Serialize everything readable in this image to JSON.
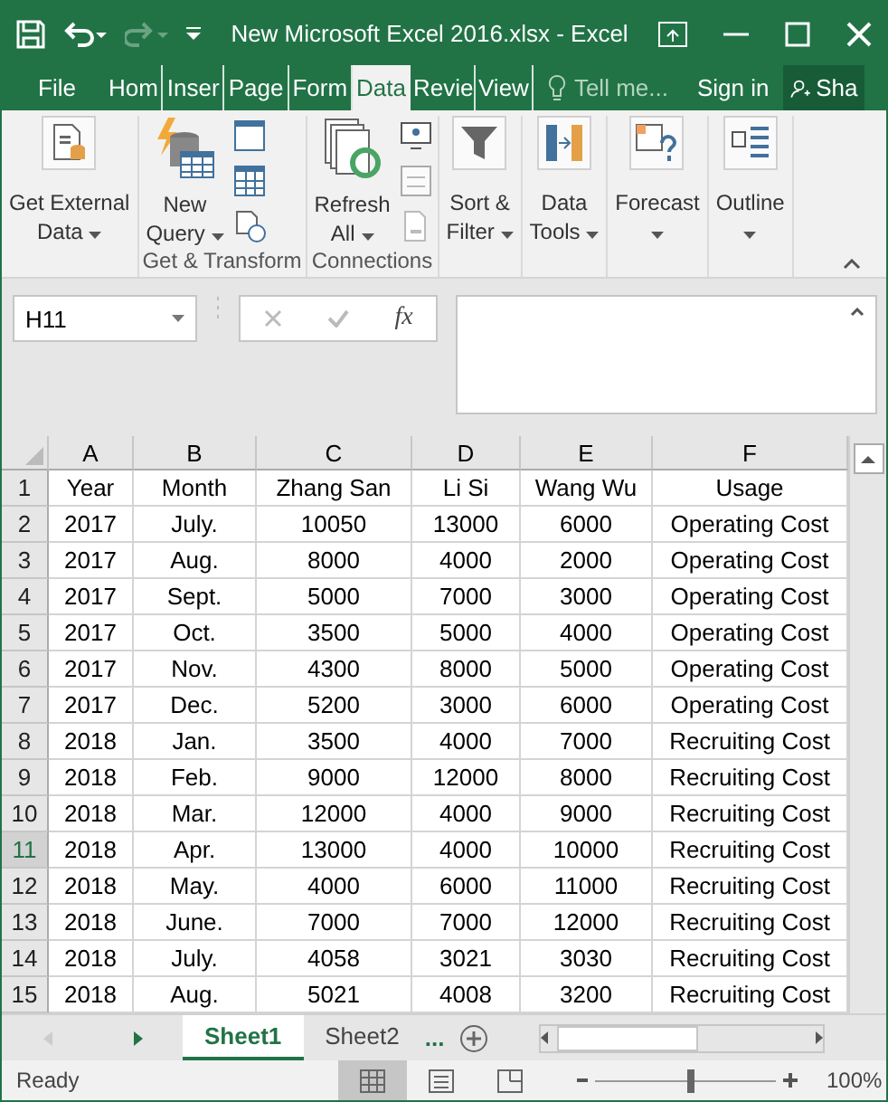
{
  "window": {
    "title": "New Microsoft Excel 2016.xlsx - Excel"
  },
  "ribbon_tabs": [
    {
      "label": "File",
      "selected": false
    },
    {
      "label": "Hom",
      "selected": false
    },
    {
      "label": "Inser",
      "selected": false
    },
    {
      "label": "Page",
      "selected": false
    },
    {
      "label": "Form",
      "selected": false
    },
    {
      "label": "Data",
      "selected": true
    },
    {
      "label": "Revie",
      "selected": false
    },
    {
      "label": "View",
      "selected": false
    }
  ],
  "tell_me": {
    "placeholder": "Tell me..."
  },
  "sign_in": "Sign in",
  "share": "Sha",
  "ribbon_groups": [
    {
      "items": [
        {
          "kind": "large",
          "lines": [
            "Get External",
            "Data"
          ]
        }
      ]
    },
    {
      "label": "Get & Transform",
      "items": [
        {
          "kind": "large",
          "lines": [
            "New",
            "Query"
          ]
        },
        {
          "kind": "smallstack"
        }
      ]
    },
    {
      "label": "Connections",
      "items": [
        {
          "kind": "large",
          "lines": [
            "Refresh",
            "All"
          ]
        },
        {
          "kind": "smallstack"
        }
      ]
    },
    {
      "items": [
        {
          "kind": "large",
          "lines": [
            "Sort &",
            "Filter"
          ]
        }
      ]
    },
    {
      "items": [
        {
          "kind": "large",
          "lines": [
            "Data",
            "Tools"
          ]
        }
      ]
    },
    {
      "items": [
        {
          "kind": "large",
          "lines": [
            "Forecast"
          ]
        }
      ]
    },
    {
      "items": [
        {
          "kind": "large",
          "lines": [
            "Outline"
          ]
        }
      ]
    }
  ],
  "name_box": "H11",
  "formula_fx": "fx",
  "sheet": {
    "columns": [
      "A",
      "B",
      "C",
      "D",
      "E",
      "F"
    ],
    "rows": [
      {
        "n": "1",
        "selected": false,
        "cells": [
          "Year",
          "Month",
          "Zhang San",
          "Li Si",
          "Wang Wu",
          "Usage"
        ]
      },
      {
        "n": "2",
        "selected": false,
        "cells": [
          "2017",
          "July.",
          "10050",
          "13000",
          "6000",
          "Operating Cost"
        ]
      },
      {
        "n": "3",
        "selected": false,
        "cells": [
          "2017",
          "Aug.",
          "8000",
          "4000",
          "2000",
          "Operating Cost"
        ]
      },
      {
        "n": "4",
        "selected": false,
        "cells": [
          "2017",
          "Sept.",
          "5000",
          "7000",
          "3000",
          "Operating Cost"
        ]
      },
      {
        "n": "5",
        "selected": false,
        "cells": [
          "2017",
          "Oct.",
          "3500",
          "5000",
          "4000",
          "Operating Cost"
        ]
      },
      {
        "n": "6",
        "selected": false,
        "cells": [
          "2017",
          "Nov.",
          "4300",
          "8000",
          "5000",
          "Operating Cost"
        ]
      },
      {
        "n": "7",
        "selected": false,
        "cells": [
          "2017",
          "Dec.",
          "5200",
          "3000",
          "6000",
          "Operating Cost"
        ]
      },
      {
        "n": "8",
        "selected": false,
        "cells": [
          "2018",
          "Jan.",
          "3500",
          "4000",
          "7000",
          "Recruiting Cost"
        ]
      },
      {
        "n": "9",
        "selected": false,
        "cells": [
          "2018",
          "Feb.",
          "9000",
          "12000",
          "8000",
          "Recruiting Cost"
        ]
      },
      {
        "n": "10",
        "selected": false,
        "cells": [
          "2018",
          "Mar.",
          "12000",
          "4000",
          "9000",
          "Recruiting Cost"
        ]
      },
      {
        "n": "11",
        "selected": true,
        "cells": [
          "2018",
          "Apr.",
          "13000",
          "4000",
          "10000",
          "Recruiting Cost"
        ]
      },
      {
        "n": "12",
        "selected": false,
        "cells": [
          "2018",
          "May.",
          "4000",
          "6000",
          "11000",
          "Recruiting Cost"
        ]
      },
      {
        "n": "13",
        "selected": false,
        "cells": [
          "2018",
          "June.",
          "7000",
          "7000",
          "12000",
          "Recruiting Cost"
        ]
      },
      {
        "n": "14",
        "selected": false,
        "cells": [
          "2018",
          "July.",
          "4058",
          "3021",
          "3030",
          "Recruiting Cost"
        ]
      },
      {
        "n": "15",
        "selected": false,
        "cells": [
          "2018",
          "Aug.",
          "5021",
          "4008",
          "3200",
          "Recruiting Cost"
        ]
      }
    ]
  },
  "sheet_tabs": [
    {
      "label": "Sheet1",
      "selected": true
    },
    {
      "label": "Sheet2",
      "selected": false
    }
  ],
  "more_sheets": "...",
  "status": "Ready",
  "views": [
    {
      "kind": "normal",
      "selected": true
    },
    {
      "kind": "page-layout",
      "selected": false
    },
    {
      "kind": "page-break",
      "selected": false
    }
  ],
  "zoom": {
    "level": 0.53,
    "reading": "100%"
  }
}
